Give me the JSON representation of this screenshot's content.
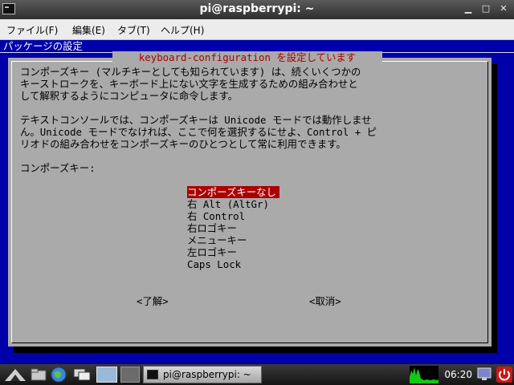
{
  "window": {
    "title": "pi@raspberrypi: ~",
    "controls": [
      "▁",
      "□",
      "✕"
    ]
  },
  "menubar": {
    "items": [
      "ファイル(F)",
      "編集(E)",
      "タブ(T)",
      "ヘルプ(H)"
    ]
  },
  "terminal": {
    "header": "パッケージの設定",
    "dialog": {
      "title": "keyboard-configuration を設定しています",
      "paragraph1": [
        "コンポーズキー (マルチキーとしても知られています) は、続くいくつかの",
        "キーストロークを、キーボード上にない文字を生成するための組み合わせと",
        "して解釈するようにコンピュータに命令します。"
      ],
      "paragraph2": [
        "テキストコンソールでは、コンポーズキーは Unicode モードでは動作しませ",
        "ん。Unicode モードでなければ、ここで何を選択するにせよ、Control + ピ",
        "リオドの組み合わせをコンポーズキーのひとつとして常に利用できます。"
      ],
      "prompt": "コンポーズキー:",
      "options": [
        "コンポーズキーなし",
        "右 Alt (AltGr)",
        "右 Control",
        "右ロゴキー",
        "メニューキー",
        "左ロゴキー",
        "Caps Lock"
      ],
      "ok_label": "<了解>",
      "cancel_label": "<取消>"
    }
  },
  "taskbar": {
    "task_label": "pi@raspberrypi: ~",
    "clock": "06:20"
  },
  "colors": {
    "terminal_bg": "#0000aa",
    "dialog_bg": "#aaaaaa",
    "title_text": "#aa0000",
    "selection": "#aa0000"
  }
}
